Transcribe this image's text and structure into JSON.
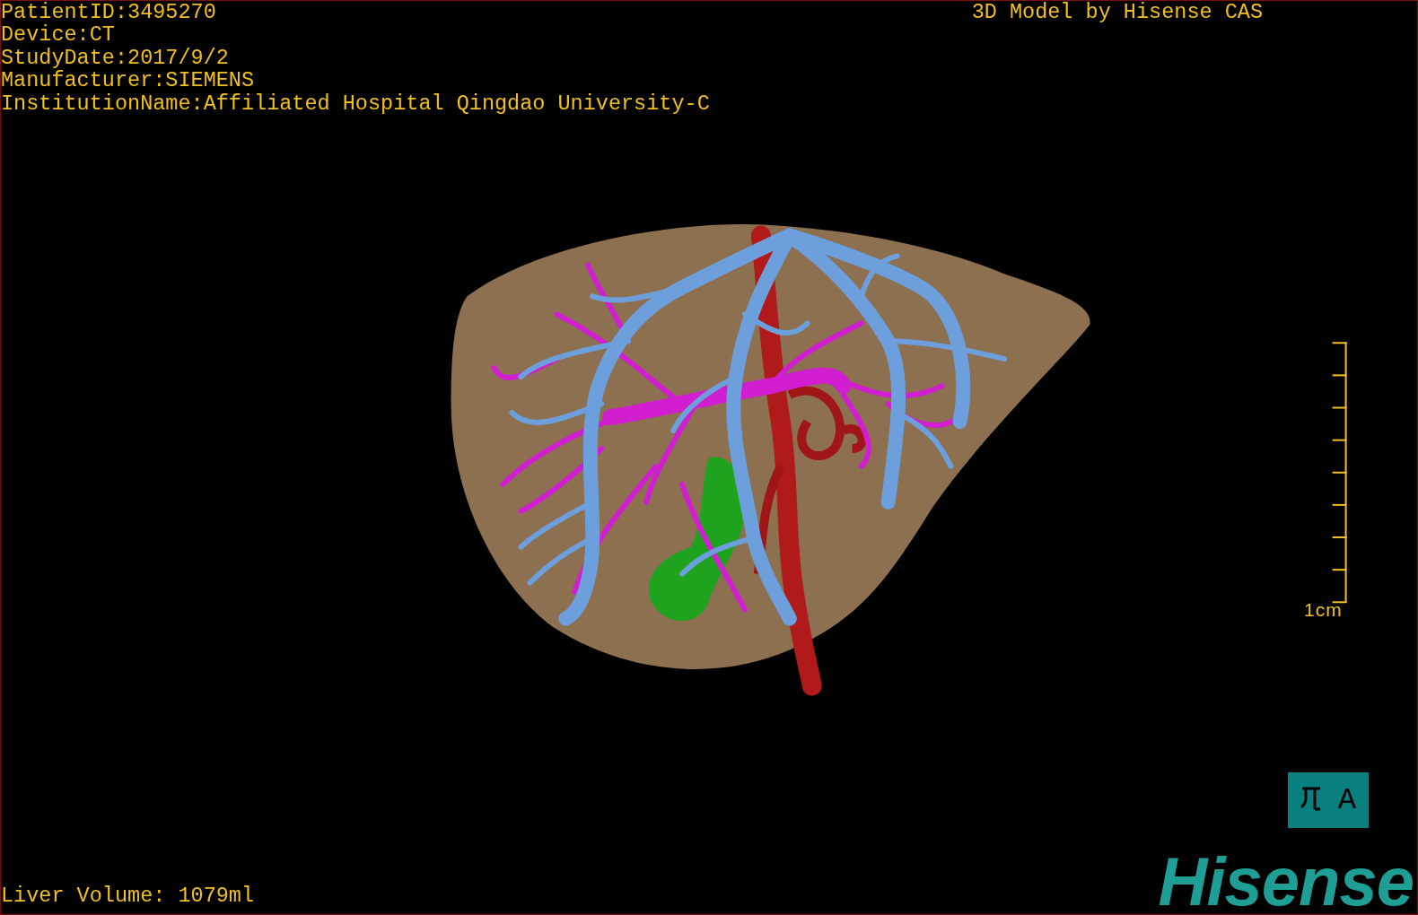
{
  "overlay": {
    "patient_info": [
      "PatientID:3495270",
      "Device:CT",
      "StudyDate:2017/9/2",
      "Manufacturer:SIEMENS",
      "InstitutionName:Affiliated Hospital Qingdao University-C"
    ],
    "title": "3D Model by Hisense CAS",
    "liver_volume": "Liver Volume: 1079ml"
  },
  "scale_bar": {
    "label": "1cm"
  },
  "orientation": {
    "label": "A"
  },
  "logo": {
    "text": "Hisense"
  }
}
